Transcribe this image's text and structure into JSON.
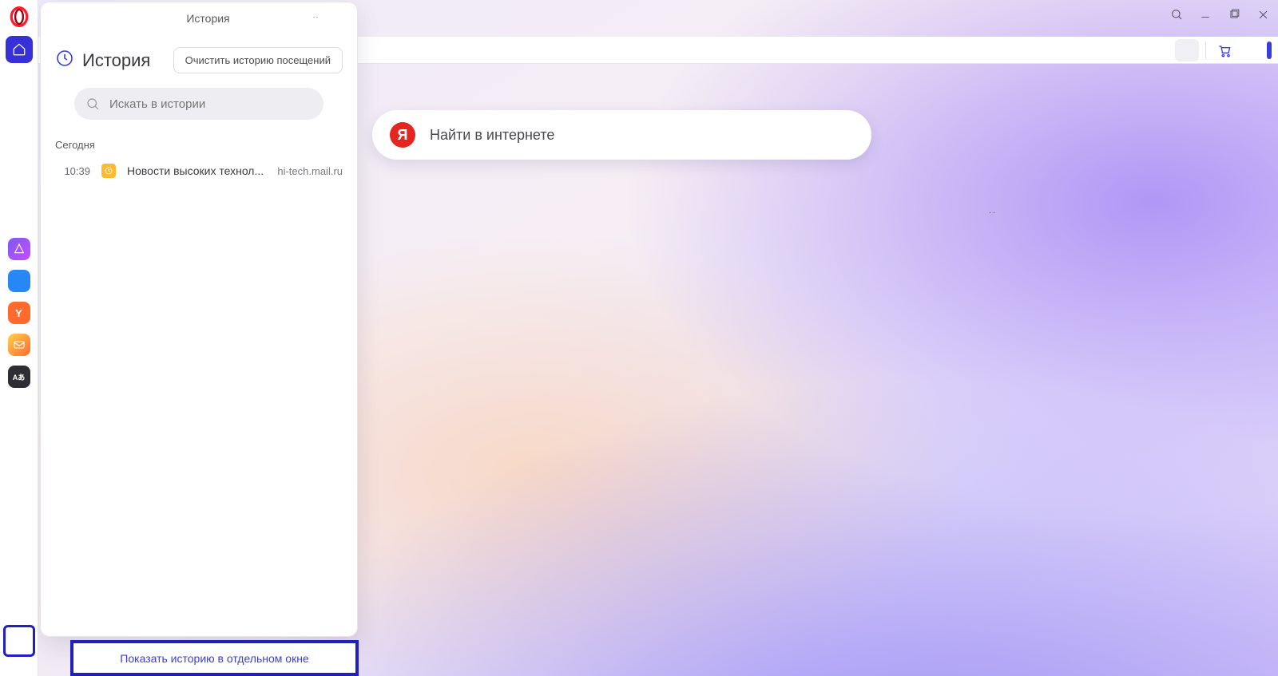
{
  "window": {
    "title": "Opera"
  },
  "addressbar": {
    "site_label": "История"
  },
  "history_panel": {
    "title": "История",
    "clear_button": "Очистить историю посещений",
    "search_placeholder": "Искать в истории",
    "section_today": "Сегодня",
    "items": [
      {
        "time": "10:39",
        "title": "Новости высоких технол...",
        "host": "hi-tech.mail.ru"
      }
    ],
    "open_full_label": "Показать историю в отдельном окне"
  },
  "yandex": {
    "placeholder": "Найти в интернете",
    "logo_letter": "Я"
  },
  "left_rail": {
    "apps": [
      {
        "name": "alice",
        "glyph": ""
      },
      {
        "name": "vk",
        "glyph": ""
      },
      {
        "name": "yandex",
        "glyph": "Y"
      },
      {
        "name": "mail",
        "glyph": ""
      },
      {
        "name": "translate",
        "glyph": "Aあ"
      }
    ]
  }
}
